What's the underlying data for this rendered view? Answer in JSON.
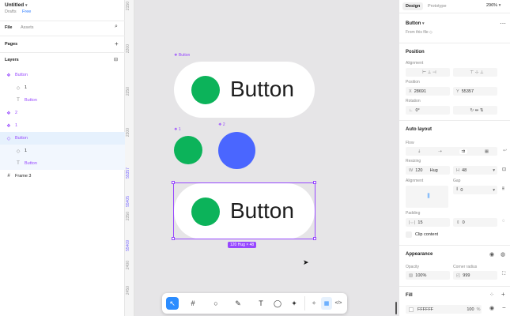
{
  "file": {
    "title": "Untitled",
    "location": "Drafts",
    "plan": "Free"
  },
  "left_tabs": {
    "file": "File",
    "assets": "Assets"
  },
  "pages": {
    "label": "Pages"
  },
  "layers": {
    "label": "Layers",
    "items": [
      {
        "name": "Button",
        "icon": "component-icon",
        "depth": 0
      },
      {
        "name": "1",
        "icon": "instance-icon",
        "depth": 1
      },
      {
        "name": "Button",
        "icon": "text-icon",
        "depth": 1
      },
      {
        "name": "2",
        "icon": "component-icon",
        "depth": 0
      },
      {
        "name": "1",
        "icon": "component-icon",
        "depth": 0
      },
      {
        "name": "Button",
        "icon": "instance-outline-icon",
        "depth": 0
      },
      {
        "name": "1",
        "icon": "instance-icon",
        "depth": 1
      },
      {
        "name": "Button",
        "icon": "text-icon",
        "depth": 1
      },
      {
        "name": "Frame 3",
        "icon": "frame-icon",
        "depth": 0
      }
    ]
  },
  "ruler": {
    "labels": [
      "2150",
      "2200",
      "2250",
      "2300",
      "55357",
      "55405",
      "2350",
      "55409",
      "2400",
      "2450"
    ]
  },
  "canvas": {
    "label_top": "Button",
    "big_button_text": "Button",
    "label_1": "1",
    "label_2": "2",
    "selected_button_text": "Button",
    "size_badge": "120 Hug × 48",
    "colors": {
      "green": "#0cb35a",
      "blue": "#4a66ff",
      "selection": "#9747ff"
    }
  },
  "right": {
    "tabs": {
      "design": "Design",
      "prototype": "Prototype"
    },
    "zoom": "296%",
    "component": {
      "name": "Button",
      "from": "From this file"
    },
    "position": {
      "label": "Position",
      "alignment": "Alignment",
      "pos_label": "Position",
      "x_label": "X",
      "x": "28691",
      "y_label": "Y",
      "y": "55357",
      "rotation_label": "Rotation",
      "rotation": "0°"
    },
    "auto_layout": {
      "label": "Auto layout",
      "flow": "Flow",
      "resizing": "Resizing",
      "w_label": "W",
      "w": "120",
      "w_mode": "Hug",
      "h_label": "H",
      "h": "48",
      "alignment": "Alignment",
      "gap": "Gap",
      "gap_value": "0",
      "padding": "Padding",
      "padding_h": "15",
      "padding_v": "0",
      "clip": "Clip content"
    },
    "appearance": {
      "label": "Appearance",
      "opacity_label": "Opacity",
      "opacity": "100%",
      "radius_label": "Corner radius",
      "radius": "999"
    },
    "fill": {
      "label": "Fill",
      "hex": "FFFFFF",
      "opacity": "100",
      "pct": "%"
    }
  }
}
